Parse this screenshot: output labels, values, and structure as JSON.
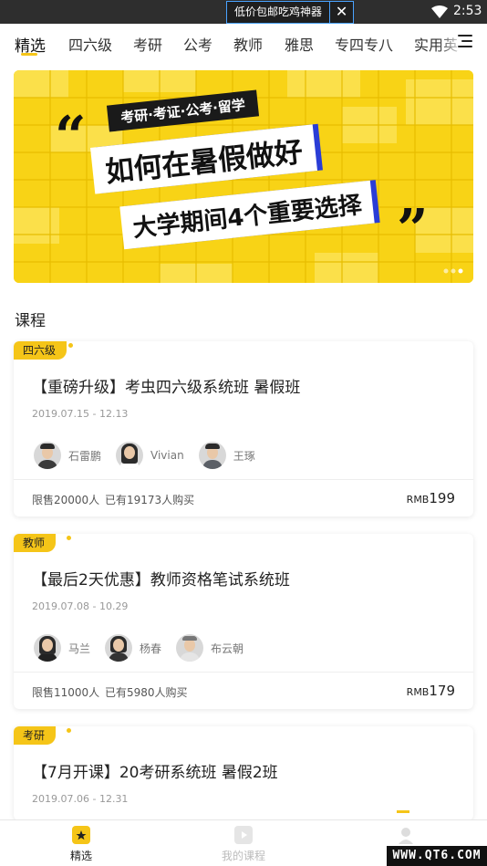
{
  "status_bar": {
    "ad_text": "低价包邮吃鸡神器",
    "ad_close": "✕",
    "time": "2:53"
  },
  "top_nav": {
    "tabs": [
      {
        "label": "精选",
        "active": true
      },
      {
        "label": "四六级"
      },
      {
        "label": "考研"
      },
      {
        "label": "公考"
      },
      {
        "label": "教师"
      },
      {
        "label": "雅思"
      },
      {
        "label": "专四专八"
      },
      {
        "label": "实用英"
      }
    ]
  },
  "banner": {
    "tags": "考研·考证·公考·留学",
    "line1": "如何在暑假做好",
    "line2": "大学期间4个重要选择",
    "open_quote": "“",
    "close_quote": "”"
  },
  "section": {
    "title": "课程"
  },
  "courses": [
    {
      "tag": "四六级",
      "title": "【重磅升级】考虫四六级系统班 暑假班",
      "dates": "2019.07.15 - 12.13",
      "teachers": [
        "石雷鹏",
        "Vivian",
        "王琢"
      ],
      "quota": "限售20000人",
      "bought": "已有19173人购买",
      "currency": "RMB",
      "price": "199"
    },
    {
      "tag": "教师",
      "title": "【最后2天优惠】教师资格笔试系统班",
      "dates": "2019.07.08 - 10.29",
      "teachers": [
        "马兰",
        "杨春",
        "布云朝"
      ],
      "quota": "限售11000人",
      "bought": "已有5980人购买",
      "currency": "RMB",
      "price": "179"
    },
    {
      "tag": "考研",
      "title": "【7月开课】20考研系统班 暑假2班",
      "dates": "2019.07.06 - 12.31"
    }
  ],
  "bottom_nav": [
    {
      "label": "精选",
      "active": true
    },
    {
      "label": "我的课程"
    },
    {
      "label": ""
    }
  ],
  "watermark": "WWW.QT6.COM",
  "colors": {
    "accent": "#f5c518",
    "banner_blue": "#2a3dd6"
  }
}
